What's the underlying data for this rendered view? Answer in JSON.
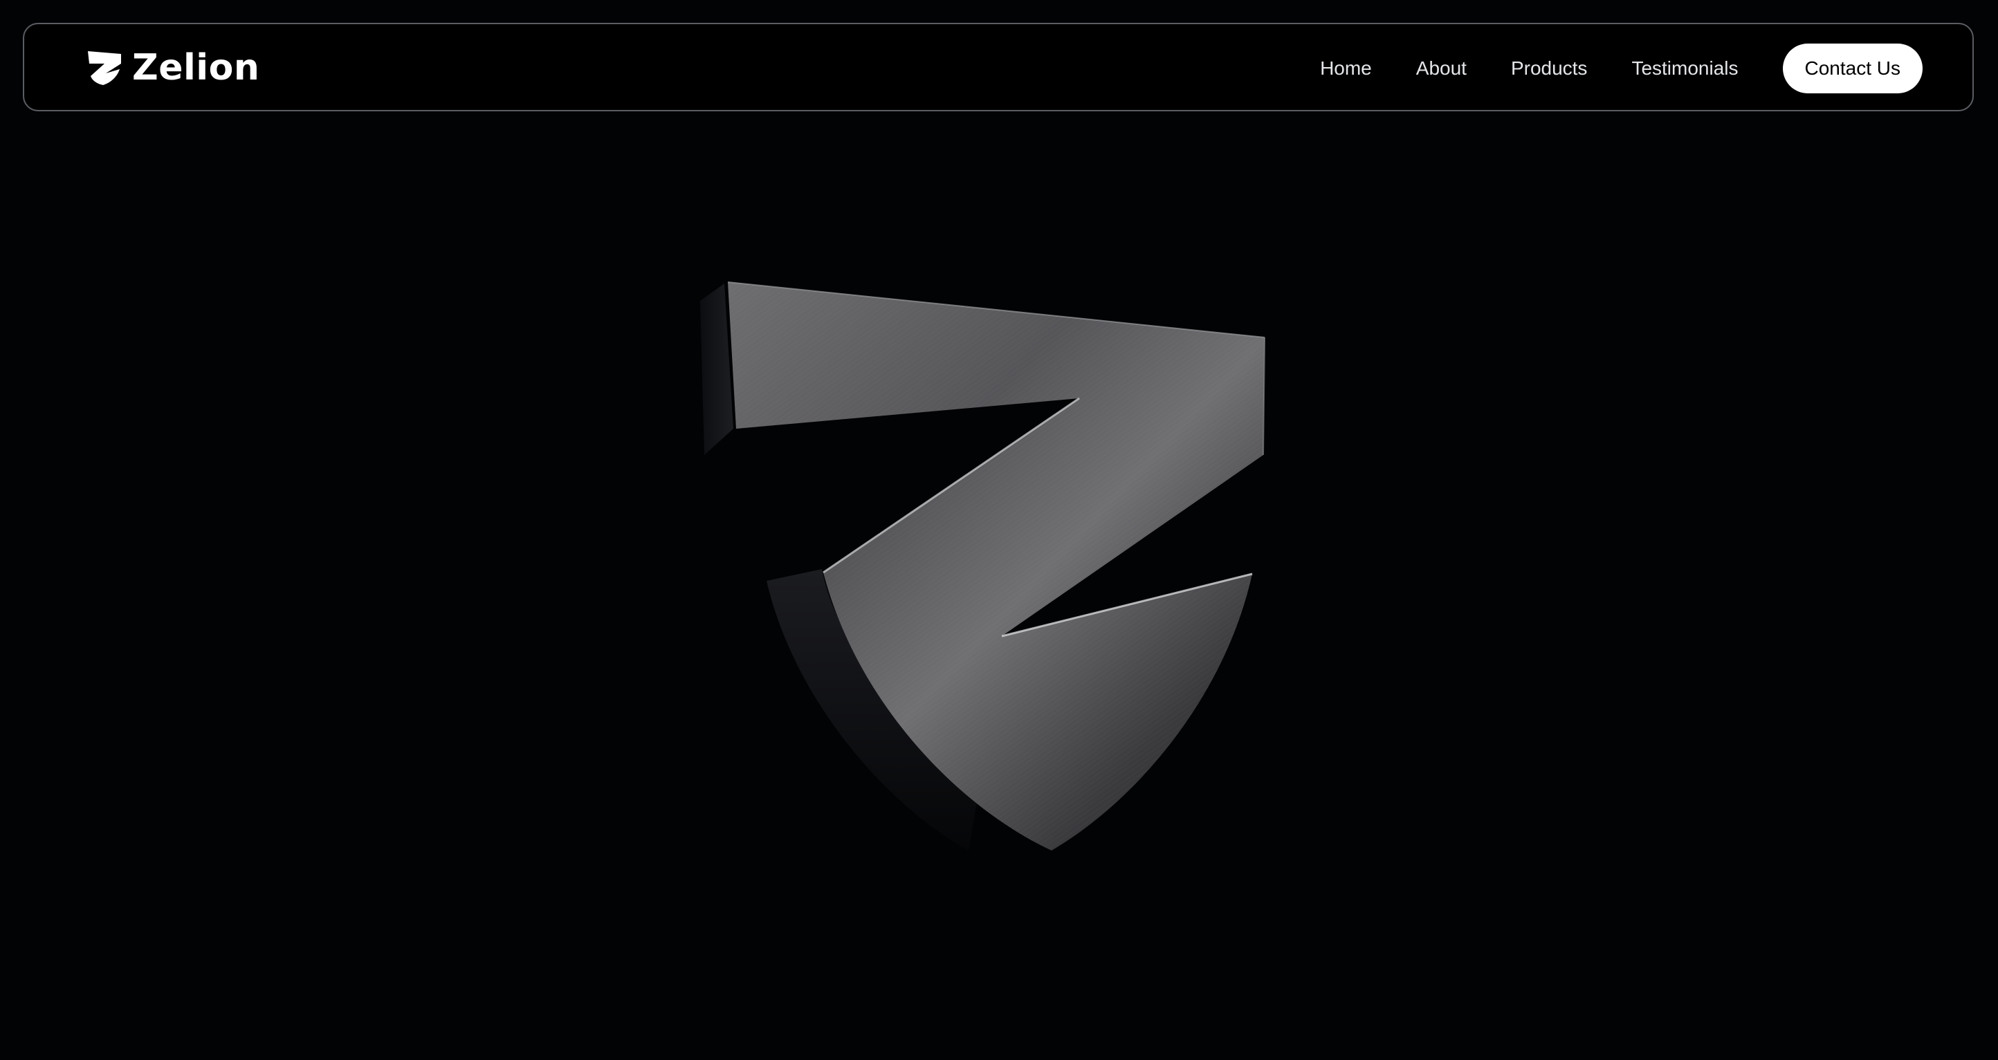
{
  "brand": {
    "name": "Zelion",
    "icon": "zelion-z-shield-icon",
    "color": "#ffffff"
  },
  "nav": {
    "items": [
      {
        "label": "Home"
      },
      {
        "label": "About"
      },
      {
        "label": "Products"
      },
      {
        "label": "Testimonials"
      }
    ],
    "cta_label": "Contact Us"
  },
  "hero": {
    "image": "metallic-z-shield-logo-3d",
    "background": "#020304"
  }
}
